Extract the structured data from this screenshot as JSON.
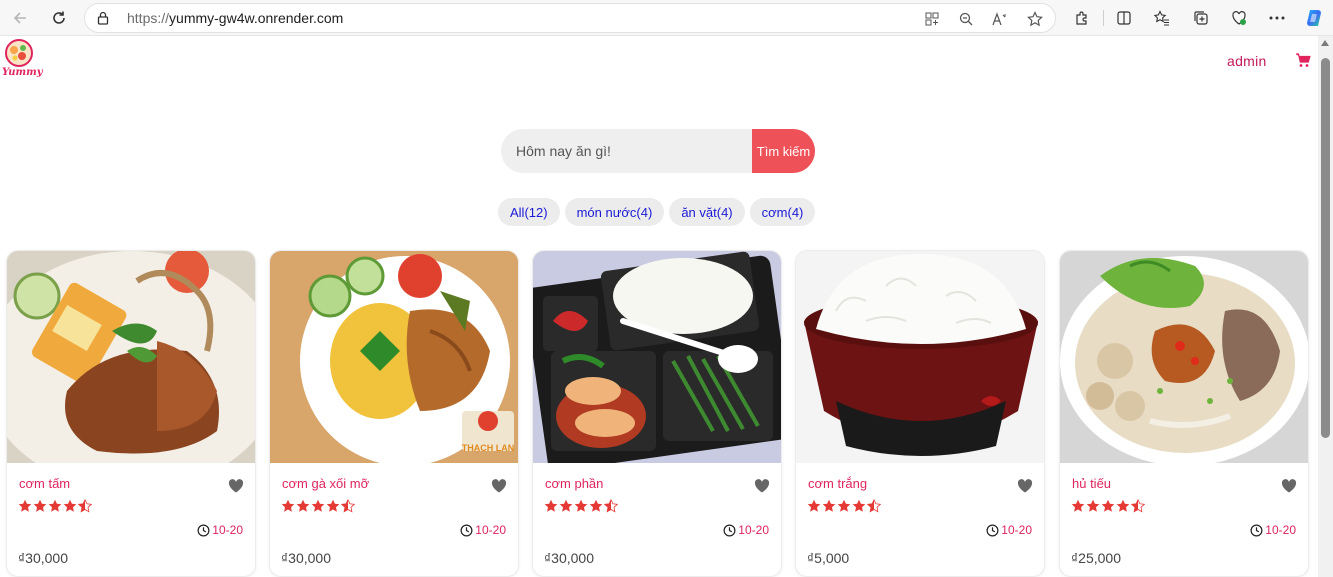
{
  "browser": {
    "url_protocol": "https://",
    "url_host": "yummy-gw4w.onrender.com"
  },
  "brand": {
    "logo_text": "Yummy",
    "accent": "#e0245e",
    "button_color": "#ee5158"
  },
  "header": {
    "admin_label": "admin"
  },
  "search": {
    "placeholder": "Hôm nay ăn gì!",
    "button_label": "Tìm kiếm"
  },
  "categories": [
    {
      "label": "All(12)"
    },
    {
      "label": "món nước(4)"
    },
    {
      "label": "ăn vặt(4)"
    },
    {
      "label": "cơm(4)"
    }
  ],
  "products": [
    {
      "name": "cơm tấm",
      "rating": 4.5,
      "time": "10-20",
      "price": "₫30,000",
      "image": "com-tam-photo"
    },
    {
      "name": "cơm gà xối mỡ",
      "rating": 4.5,
      "time": "10-20",
      "price": "₫30,000",
      "image": "com-ga-photo"
    },
    {
      "name": "cơm phần",
      "rating": 4.5,
      "time": "10-20",
      "price": "₫30,000",
      "image": "com-phan-photo"
    },
    {
      "name": "cơm trắng",
      "rating": 4.5,
      "time": "10-20",
      "price": "₫5,000",
      "image": "com-trang-photo"
    },
    {
      "name": "hủ tiếu",
      "rating": 4.5,
      "time": "10-20",
      "price": "₫25,000",
      "image": "hu-tieu-photo"
    }
  ]
}
